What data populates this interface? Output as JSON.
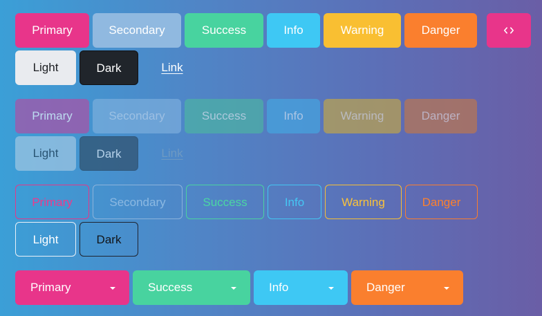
{
  "solid": {
    "primary": "Primary",
    "secondary": "Secondary",
    "success": "Success",
    "info": "Info",
    "warning": "Warning",
    "danger": "Danger",
    "light": "Light",
    "dark": "Dark",
    "link": "Link",
    "icon_button_icon": "code-icon"
  },
  "disabled": {
    "primary": "Primary",
    "secondary": "Secondary",
    "success": "Success",
    "info": "Info",
    "warning": "Warning",
    "danger": "Danger",
    "light": "Light",
    "dark": "Dark",
    "link": "Link"
  },
  "outline": {
    "primary": "Primary",
    "secondary": "Secondary",
    "success": "Success",
    "info": "Info",
    "warning": "Warning",
    "danger": "Danger",
    "light": "Light",
    "dark": "Dark"
  },
  "dropdowns": {
    "primary": "Primary",
    "success": "Success",
    "info": "Info",
    "danger": "Danger"
  },
  "colors": {
    "primary": "#e8358a",
    "secondary": "#90b9e0",
    "success": "#48d39f",
    "info": "#3ec8f4",
    "warning": "#f9bf32",
    "danger": "#fa7f2e",
    "light": "#e9ebef",
    "dark": "#20252b"
  }
}
